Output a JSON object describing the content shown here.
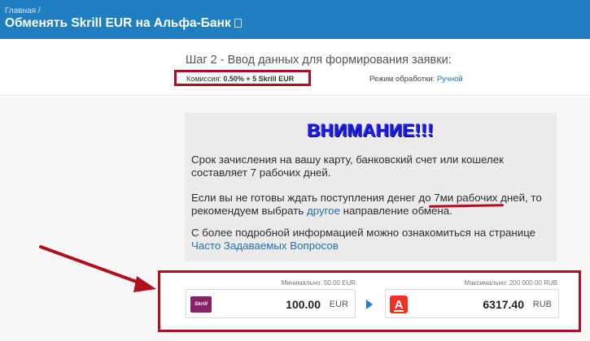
{
  "header": {
    "breadcrumb": "Главная",
    "breadcrumb_sep": "/",
    "title": "Обменять Skrill EUR на Альфа-Банк"
  },
  "step": {
    "title": "Шаг 2 - Ввод данных для формирования заявки:",
    "commission_label": "Комиссия:",
    "commission_value": "0.50% + 5 Skrill EUR",
    "processing_label": "Режим обработки:",
    "processing_value": "Ручной"
  },
  "notice": {
    "title": "ВНИМАНИЕ!!!",
    "p1": "Срок зачисления на вашу карту, банковский счет или кошелек составляет 7 рабочих дней.",
    "p2_a": "Если вы не готовы ждать поступления денег до ",
    "p2_emph": "7ми рабочих",
    "p2_b": " дней, то рекомендуем выбрать ",
    "p2_link": "другое",
    "p2_c": " направление обмена.",
    "p3_a": "С более подробной информацией можно ознакомиться на странице ",
    "p3_link": "Часто Задаваемых Вопросов"
  },
  "exchange": {
    "from": {
      "limit_label": "Минимально:",
      "limit_value": "50.00 EUR",
      "logo_text": "Skrill",
      "amount": "100.00",
      "currency": "EUR"
    },
    "to": {
      "limit_label": "Максимально:",
      "limit_value": "200 000.00 RUB",
      "logo_text": "А",
      "amount": "6317.40",
      "currency": "RUB"
    }
  },
  "colors": {
    "header_bg": "#1f7fc0",
    "highlight_red": "#b10f1f",
    "notice_title": "#1a1aef",
    "link": "#1f6fb5",
    "skrill_brand": "#862165",
    "alfa_brand": "#ef3124"
  }
}
